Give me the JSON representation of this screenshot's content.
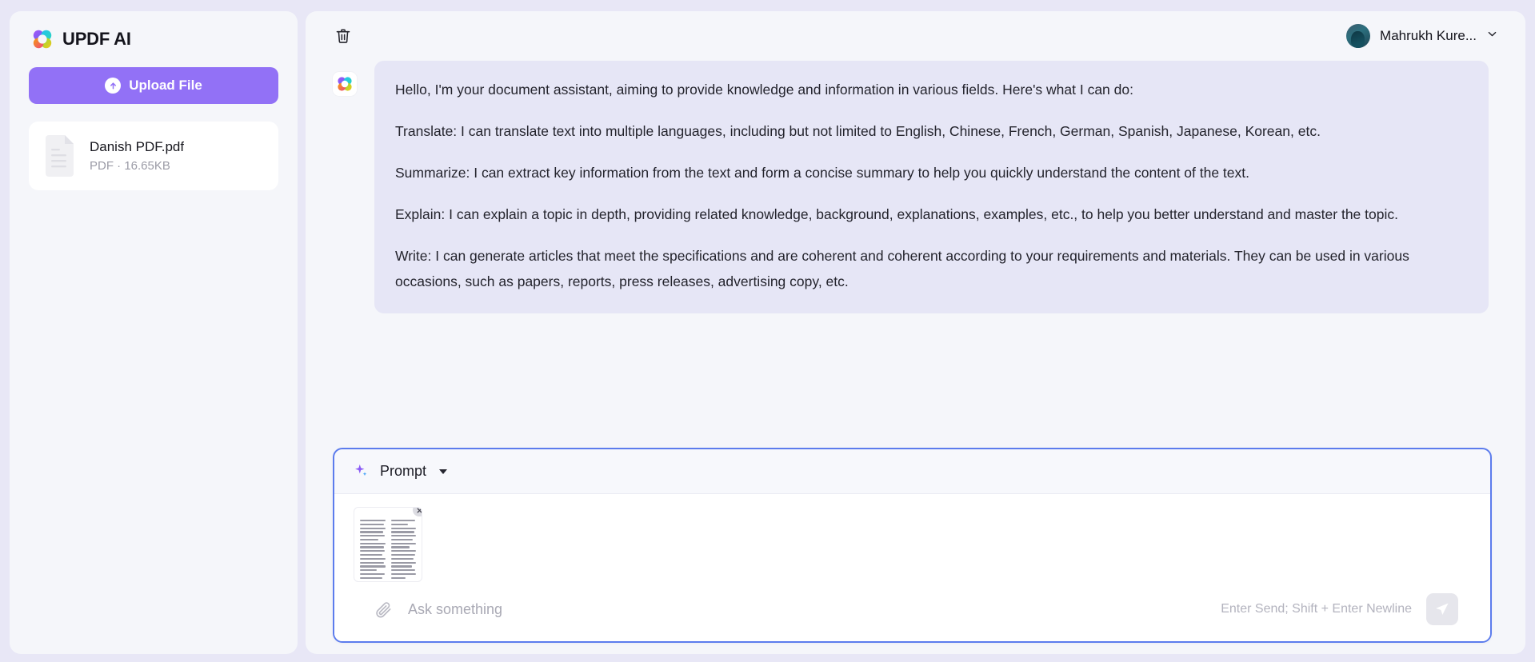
{
  "brand": {
    "title": "UPDF AI",
    "logo_icon": "flower-logo-icon"
  },
  "sidebar": {
    "upload_button": {
      "label": "Upload File",
      "icon": "upload-arrow-icon"
    },
    "files": [
      {
        "name": "Danish PDF.pdf",
        "meta": "PDF · 16.65KB",
        "icon": "document-file-icon"
      }
    ]
  },
  "header": {
    "delete_icon": "trash-icon",
    "user": {
      "name": "Mahrukh Kure...",
      "avatar_icon": "user-avatar",
      "chevron_icon": "chevron-down-icon"
    }
  },
  "conversation": {
    "messages": [
      {
        "role": "assistant",
        "avatar_icon": "assistant-flower-icon",
        "paragraphs": [
          "Hello, I'm your document assistant, aiming to provide knowledge and information in various fields. Here's what I can do:",
          "Translate: I can translate text into multiple languages, including but not limited to English, Chinese, French, German, Spanish, Japanese, Korean, etc.",
          "Summarize: I can extract key information from the text and form a concise summary to help you quickly understand the content of the text.",
          "Explain: I can explain a topic in depth, providing related knowledge, background, explanations, examples, etc., to help you better understand and master the topic.",
          "Write: I can generate articles that meet the specifications and are coherent and coherent according to your requirements and materials. They can be used in various occasions, such as papers, reports, press releases, advertising copy, etc."
        ]
      }
    ]
  },
  "composer": {
    "prompt": {
      "label": "Prompt",
      "sparkle_icon": "sparkle-icon",
      "caret_icon": "caret-down-icon"
    },
    "attachment": {
      "name": "document-thumbnail",
      "remove_icon": "close-icon"
    },
    "attach_icon": "paperclip-icon",
    "input_placeholder": "Ask something",
    "input_value": "",
    "send_hint": "Enter Send; Shift + Enter Newline",
    "send_icon": "send-plane-icon"
  },
  "colors": {
    "accent_purple": "#9271f6",
    "focus_blue": "#5c7ced",
    "bubble": "#e6e6f6",
    "panel": "#f5f6fa",
    "page_bg": "#e8e7f6"
  }
}
